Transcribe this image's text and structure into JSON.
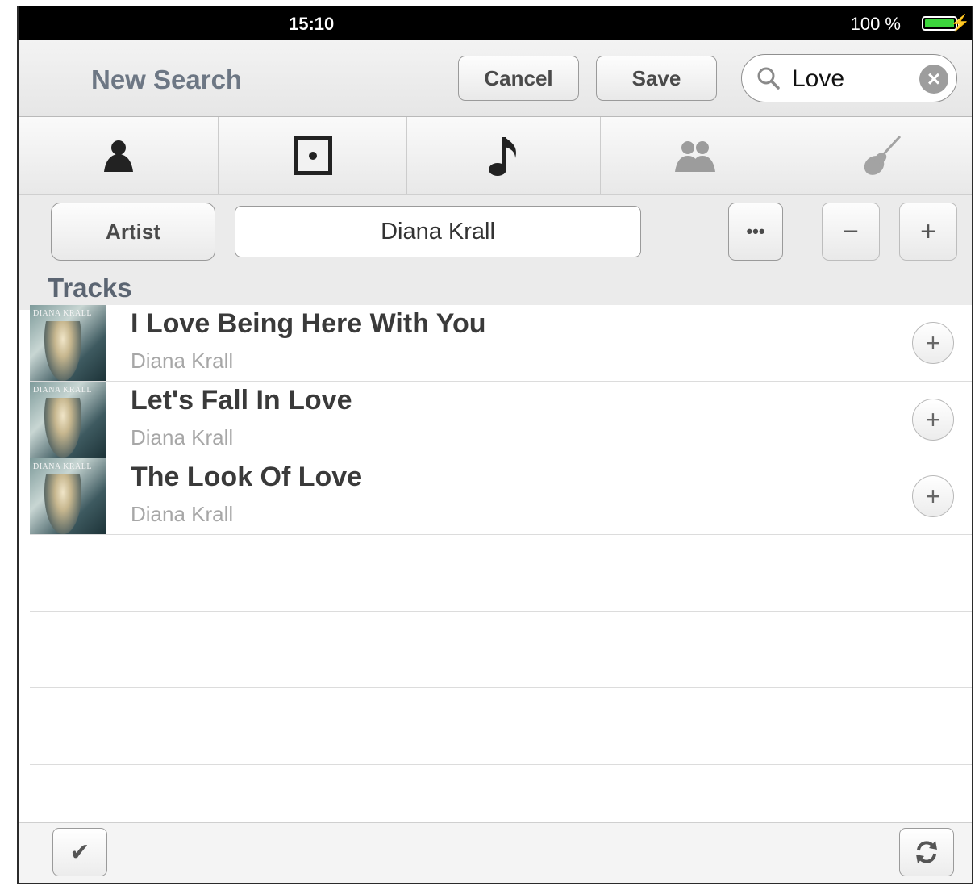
{
  "status_bar": {
    "time": "15:10",
    "battery_text": "100 %"
  },
  "header": {
    "title": "New Search",
    "cancel_label": "Cancel",
    "save_label": "Save",
    "search": {
      "value": "Love"
    }
  },
  "tabs": [
    {
      "icon": "person-icon",
      "selected": true
    },
    {
      "icon": "album-icon",
      "selected": true
    },
    {
      "icon": "music-note-icon",
      "selected": true
    },
    {
      "icon": "group-icon",
      "selected": false
    },
    {
      "icon": "guitar-icon",
      "selected": false
    }
  ],
  "filter": {
    "type_label": "Artist",
    "value": "Diana Krall",
    "more_label": "•••",
    "minus_label": "−",
    "plus_label": "+"
  },
  "section_title": "Tracks",
  "tracks": [
    {
      "title": "I Love Being Here With You",
      "artist": "Diana Krall",
      "cover_text": "DIANA KRALL"
    },
    {
      "title": "Let's Fall In Love",
      "artist": "Diana Krall",
      "cover_text": "DIANA KRALL"
    },
    {
      "title": "The Look Of Love",
      "artist": "Diana Krall",
      "cover_text": "DIANA KRALL"
    }
  ],
  "add_label": "+",
  "toolbar": {
    "check_label": "✔",
    "refresh_icon": "refresh-icon"
  }
}
